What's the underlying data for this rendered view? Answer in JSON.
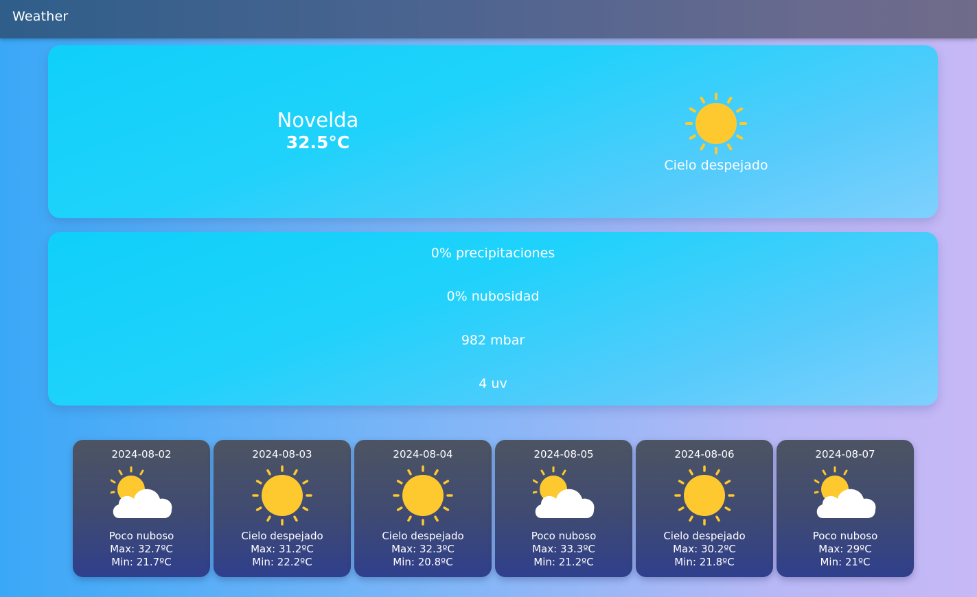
{
  "header": {
    "title": "Weather"
  },
  "current": {
    "city": "Novelda",
    "temperature": "32.5°C",
    "condition": "Cielo despejado",
    "icon": "sun-icon"
  },
  "details": {
    "precipitation": "0% precipitaciones",
    "cloudiness": "0% nubosidad",
    "pressure": "982 mbar",
    "uv": "4 uv"
  },
  "forecast": [
    {
      "date": "2024-08-02",
      "condition": "Poco nuboso",
      "max": "Max: 32.7ºC",
      "min": "Min: 21.7ºC",
      "icon": "partly-cloudy-icon"
    },
    {
      "date": "2024-08-03",
      "condition": "Cielo despejado",
      "max": "Max: 31.2ºC",
      "min": "Min: 22.2ºC",
      "icon": "sun-icon"
    },
    {
      "date": "2024-08-04",
      "condition": "Cielo despejado",
      "max": "Max: 32.3ºC",
      "min": "Min: 20.8ºC",
      "icon": "sun-icon"
    },
    {
      "date": "2024-08-05",
      "condition": "Poco nuboso",
      "max": "Max: 33.3ºC",
      "min": "Min: 21.2ºC",
      "icon": "partly-cloudy-icon"
    },
    {
      "date": "2024-08-06",
      "condition": "Cielo despejado",
      "max": "Max: 30.2ºC",
      "min": "Min: 21.8ºC",
      "icon": "sun-icon"
    },
    {
      "date": "2024-08-07",
      "condition": "Poco nuboso",
      "max": "Max: 29ºC",
      "min": "Min: 21ºC",
      "icon": "partly-cloudy-icon"
    }
  ],
  "colors": {
    "sun": "#fdc92f",
    "cloud": "#ffffff"
  }
}
